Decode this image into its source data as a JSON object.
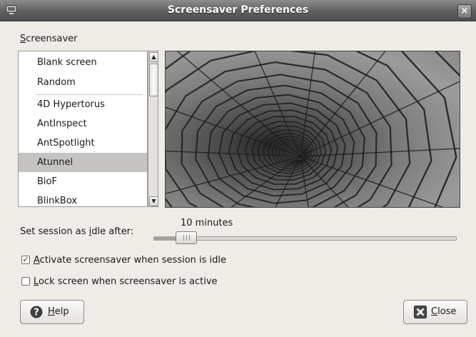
{
  "window": {
    "title": "Screensaver Preferences",
    "icon": "monitor-icon",
    "close_icon": "close-icon"
  },
  "screensaver": {
    "section_label_first": "S",
    "section_label_rest": "creensaver",
    "items": [
      {
        "label": "Blank screen"
      },
      {
        "label": "Random"
      },
      {
        "label": "4D Hypertorus"
      },
      {
        "label": "AntInspect"
      },
      {
        "label": "AntSpotlight"
      },
      {
        "label": "Atunnel",
        "selected": true
      },
      {
        "label": "BioF"
      },
      {
        "label": "BlinkBox"
      }
    ],
    "preview": "tunnel-preview-image"
  },
  "idle": {
    "label_pre": "Set session as ",
    "label_ul": "i",
    "label_post": "dle after:",
    "value": "10 minutes",
    "level_fraction": 0.07
  },
  "options": {
    "activate": {
      "checked": true,
      "mnemonic": "A",
      "rest": "ctivate screensaver when session is idle"
    },
    "lock": {
      "checked": false,
      "mnemonic": "L",
      "rest": "ock screen when screensaver is active"
    }
  },
  "buttons": {
    "help": {
      "mnemonic": "H",
      "rest": "elp",
      "icon": "help-icon"
    },
    "close": {
      "mnemonic": "C",
      "rest": "lose",
      "icon": "close-icon"
    }
  },
  "colors": {
    "titlebar": "#5f5f5f",
    "selection": "#c6c4c2",
    "background": "#efebe7"
  }
}
